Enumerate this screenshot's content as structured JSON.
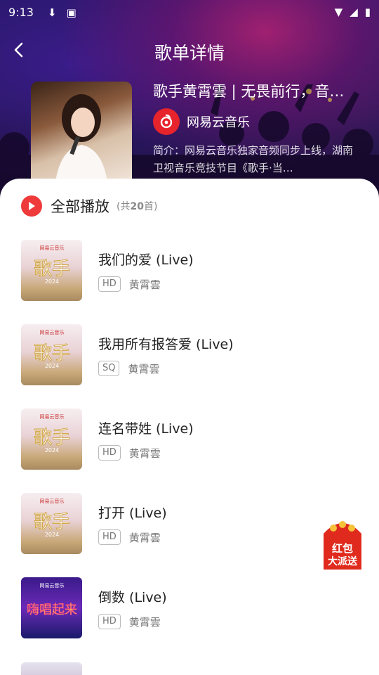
{
  "status_bar": {
    "time": "9:13"
  },
  "header": {
    "title": "歌单详情"
  },
  "playlist": {
    "name": "歌手黄霄雲 | 无畏前行，音…",
    "creator": "网易云音乐",
    "intro": "简介：网易云音乐独家音频同步上线，湖南卫视音乐竞技节目《歌手·当…"
  },
  "play_all": {
    "label": "全部播放",
    "count_prefix": "(共",
    "count_num": "20",
    "count_suffix": "首)"
  },
  "songs": [
    {
      "title": "我们的爱 (Live)",
      "quality": "HD",
      "artist": "黄霄雲"
    },
    {
      "title": "我用所有报答爱 (Live)",
      "quality": "SQ",
      "artist": "黄霄雲"
    },
    {
      "title": "连名带姓 (Live)",
      "quality": "HD",
      "artist": "黄霄雲"
    },
    {
      "title": "打开 (Live)",
      "quality": "HD",
      "artist": "黄霄雲"
    },
    {
      "title": "倒数 (Live)",
      "quality": "HD",
      "artist": "黄霄雲"
    }
  ],
  "thumb_labels": {
    "brand": "网易云音乐",
    "show": "歌手",
    "year": "2024",
    "alt_show": "嗨唱起来"
  },
  "red_packet": {
    "line1": "红包",
    "line2": "大派送"
  },
  "colors": {
    "accent": "#ee3a3a",
    "netease_red": "#e7232c"
  }
}
